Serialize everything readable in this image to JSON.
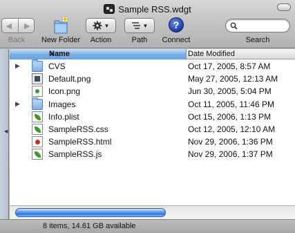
{
  "window": {
    "title": "Sample RSS.wdgt"
  },
  "toolbar": {
    "back_label": "Back",
    "new_folder_label": "New Folder",
    "action_label": "Action",
    "path_label": "Path",
    "connect_label": "Connect",
    "search_label": "Search",
    "search_placeholder": ""
  },
  "columns": {
    "name": "Name",
    "date_modified": "Date Modified"
  },
  "files": [
    {
      "name": "CVS",
      "date": "Oct 17, 2005, 8:57 AM",
      "icon": "folder-icon",
      "expandable": true
    },
    {
      "name": "Default.png",
      "date": "May 27, 2005, 12:13 AM",
      "icon": "image-file-icon",
      "expandable": false
    },
    {
      "name": "Icon.png",
      "date": "Jun 30, 2005, 5:04 PM",
      "icon": "image-file-icon",
      "expandable": false
    },
    {
      "name": "Images",
      "date": "Oct 11, 2005, 11:46 PM",
      "icon": "folder-icon",
      "expandable": true
    },
    {
      "name": "Info.plist",
      "date": "Oct 15, 2006, 1:13 PM",
      "icon": "plist-file-icon",
      "expandable": false
    },
    {
      "name": "SampleRSS.css",
      "date": "Oct 12, 2005, 12:10 AM",
      "icon": "css-file-icon",
      "expandable": false
    },
    {
      "name": "SampleRSS.html",
      "date": "Nov 29, 2006, 1:36 PM",
      "icon": "html-file-icon",
      "expandable": false
    },
    {
      "name": "SampleRSS.js",
      "date": "Nov 29, 2006, 1:37 PM",
      "icon": "js-file-icon",
      "expandable": false
    }
  ],
  "status": {
    "text": "8 items, 14.61 GB available"
  },
  "colors": {
    "header_selected": "#6b9fdf",
    "scroll_thumb": "#2f74d6"
  }
}
